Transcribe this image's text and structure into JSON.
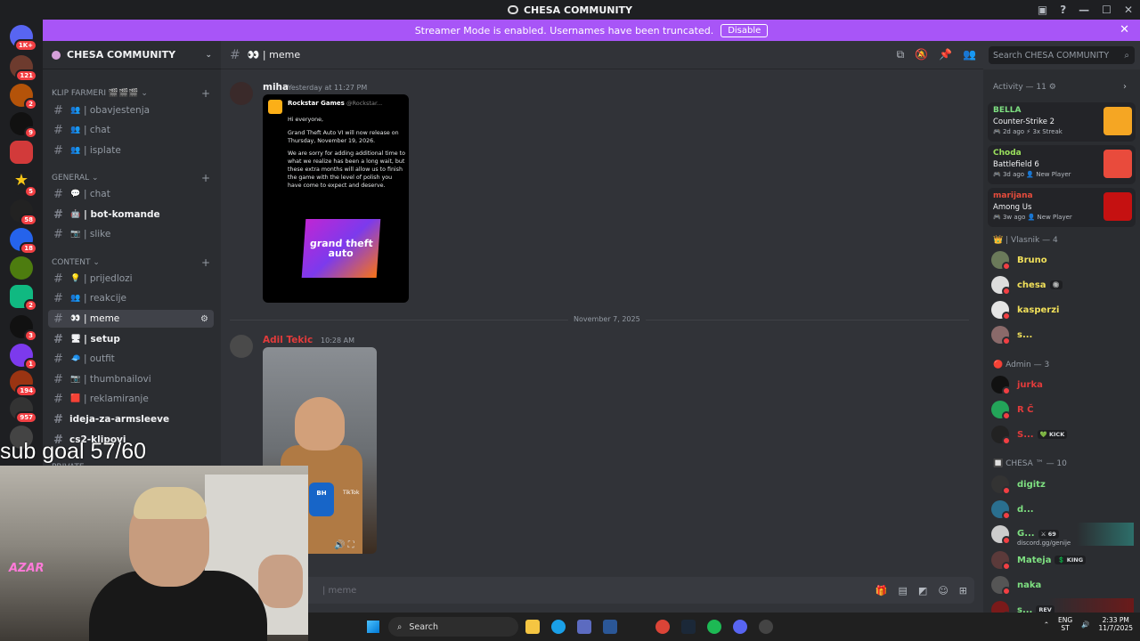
{
  "window": {
    "title": "CHESA COMMUNITY"
  },
  "banner": {
    "text": "Streamer Mode is enabled. Usernames have been truncated.",
    "button": "Disable"
  },
  "rail": {
    "badges": [
      "1K+",
      "121",
      "2",
      "9",
      "5",
      "58",
      "18",
      "2",
      "3",
      "1",
      "194",
      "957"
    ]
  },
  "server": {
    "name": "CHESA COMMUNITY"
  },
  "categories": [
    {
      "label": "KLIP FARMERI 🎬🎬🎬"
    },
    {
      "label": "GENERAL"
    },
    {
      "label": "CONTENT"
    },
    {
      "label": "PRIVATE"
    }
  ],
  "channels": [
    {
      "emoji": "👥",
      "label": "| obavjestenja"
    },
    {
      "emoji": "👥",
      "label": "| chat"
    },
    {
      "emoji": "👥",
      "label": "| isplate"
    },
    {
      "emoji": "💬",
      "label": "| chat"
    },
    {
      "emoji": "🤖",
      "label": "| bot-komande"
    },
    {
      "emoji": "📷",
      "label": "| slike"
    },
    {
      "emoji": "💡",
      "label": "| prijedlozi"
    },
    {
      "emoji": "👥",
      "label": "| reakcije"
    },
    {
      "emoji": "👀",
      "label": "| meme"
    },
    {
      "emoji": "🖥",
      "label": "| setup"
    },
    {
      "emoji": "🧢",
      "label": "| outfit"
    },
    {
      "emoji": "📷",
      "label": "| thumbnailovi"
    },
    {
      "emoji": "🟥",
      "label": "| reklamiranje"
    },
    {
      "emoji": "",
      "label": "ideja-za-armsleeve"
    },
    {
      "emoji": "",
      "label": "cs2-klipovi"
    }
  ],
  "header": {
    "channel": "👀 | meme",
    "search_placeholder": "Search CHESA COMMUNITY"
  },
  "messages": [
    {
      "author": "miha",
      "time": "Yesterday at 11:27 PM",
      "embed": {
        "account": "Rockstar Games",
        "handle": "@Rockstar...",
        "lines": [
          "Hi everyone,",
          "Grand Theft Auto VI will now release on Thursday, November 19, 2026.",
          "We are sorry for adding additional time to what we realize has been a long wait, but these extra months will allow us to finish the game with the level of polish you have come to expect and deserve."
        ],
        "logo_text": "grand theft auto"
      }
    },
    {
      "author": "Adil Tekic",
      "time": "10:28 AM",
      "video": {
        "tiktok": "TikTok",
        "handle": "@armin.hamzic",
        "mic_label": "BH"
      }
    }
  ],
  "date_divider": "November 7, 2025",
  "composer": {
    "placeholder": "| meme"
  },
  "activity": {
    "title": "Activity — 11",
    "items": [
      {
        "user": "BELLA",
        "game": "Counter-Strike 2",
        "meta": "🎮 2d ago  ⚡ 3x Streak",
        "color": "#7ee081",
        "thumb": "#f5a623"
      },
      {
        "user": "Choda",
        "game": "Battlefield 6",
        "meta": "🎮 3d ago  👤 New Player",
        "color": "#9be15d",
        "thumb": "#e94b3c"
      },
      {
        "user": "marijana",
        "game": "Among Us",
        "meta": "🎮 3w ago  👤 New Player",
        "color": "#e74c3c",
        "thumb": "#c51111"
      }
    ]
  },
  "roles": [
    {
      "label": "👑 | Vlasnik — 4",
      "members": [
        {
          "name": "Bruno",
          "color": "#f1e05a",
          "tag": ""
        },
        {
          "name": "chesa",
          "color": "#f1e05a",
          "tag": "🔘"
        },
        {
          "name": "kasperzi",
          "color": "#f1e05a",
          "tag": ""
        },
        {
          "name": "s...",
          "color": "#f1e05a",
          "tag": ""
        }
      ]
    },
    {
      "label": "🔴 Admin — 3",
      "members": [
        {
          "name": "jurka",
          "color": "#e23b3b",
          "tag": ""
        },
        {
          "name": "R Č",
          "color": "#e23b3b",
          "tag": ""
        },
        {
          "name": "S...",
          "color": "#e23b3b",
          "tag": "💚 KICK"
        }
      ]
    },
    {
      "label": "🔲 CHESA ™ — 10",
      "members": [
        {
          "name": "digitz",
          "color": "#7ee081",
          "tag": ""
        },
        {
          "name": "d...",
          "color": "#7ee081",
          "tag": ""
        },
        {
          "name": "G...",
          "color": "#7ee081",
          "tag": "⚔ 69"
        },
        {
          "name": "Mateja",
          "color": "#7ee081",
          "tag": "💲 KING"
        },
        {
          "name": "naka",
          "color": "#7ee081",
          "tag": ""
        },
        {
          "name": "s...",
          "color": "#7ee081",
          "tag": "REV"
        }
      ]
    }
  ],
  "member_sub": {
    "text": "discord.gg/genije"
  },
  "overlay": {
    "sub_goal": "sub goal 57/60",
    "neon": "AZAR"
  },
  "taskbar": {
    "search": "Search",
    "lang": "ENG",
    "lang2": "ST",
    "time": "2:33 PM",
    "date": "11/7/2025"
  }
}
